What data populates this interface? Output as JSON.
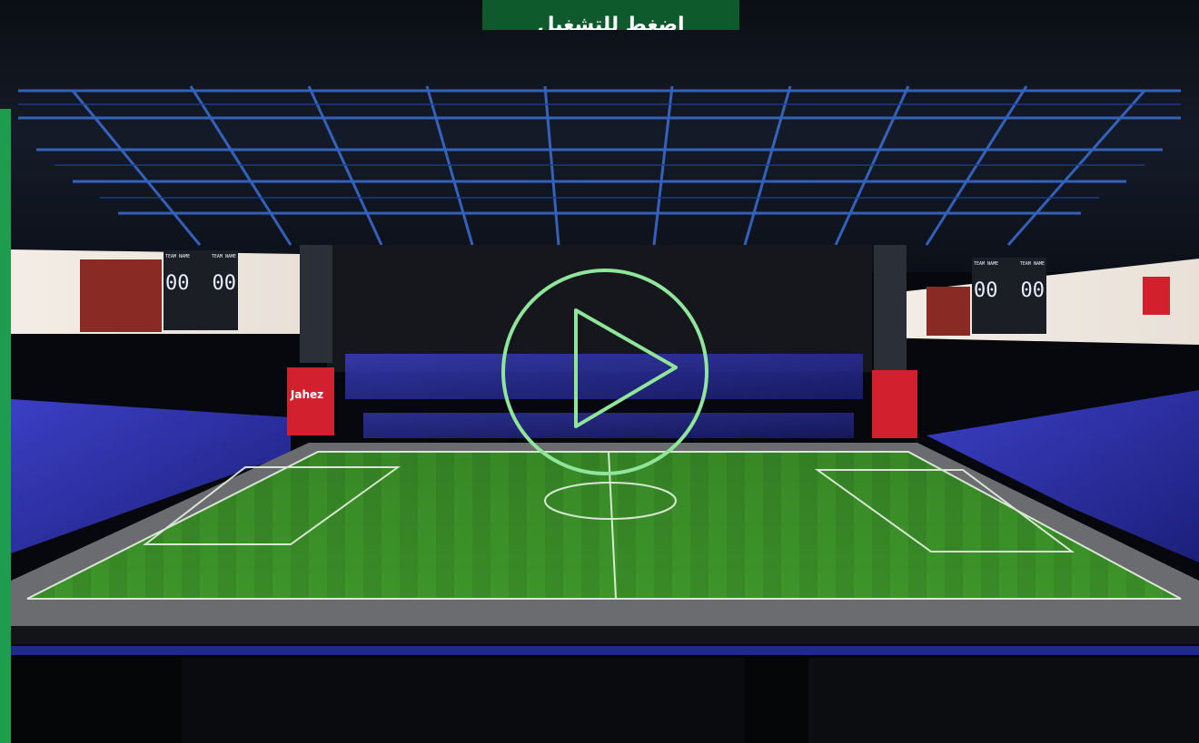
{
  "play_overlay_label": "اضغط للتشغيل",
  "scoreboard_left": {
    "home_label": "TEAM NAME",
    "away_label": "TEAM NAME",
    "home_score": "00",
    "away_score": "00"
  },
  "scoreboard_right": {
    "home_label": "TEAM NAME",
    "away_label": "TEAM NAME",
    "home_score": "00",
    "away_score": "00"
  },
  "sponsor_banner_left": {
    "brand": "Jahez"
  },
  "icons": {
    "play": "play-icon"
  },
  "colors": {
    "accent_green": "#1f9d4e",
    "button_green": "#0e5a2c",
    "play_ring": "#8fe59a",
    "banner_red": "#d3202f"
  }
}
